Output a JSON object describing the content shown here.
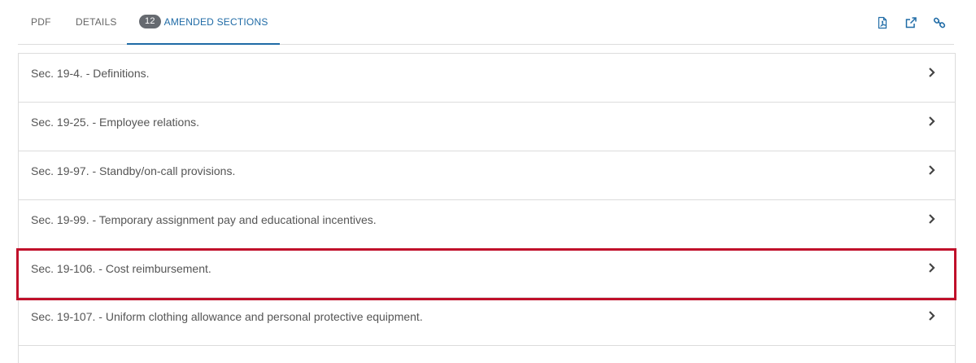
{
  "tabs": {
    "pdf": "PDF",
    "details": "DETAILS",
    "amended_count": "12",
    "amended": "AMENDED SECTIONS"
  },
  "toolbar": {
    "icons": [
      "pdf-file-icon",
      "external-link-icon",
      "link-icon"
    ],
    "accent_color": "#1f6ba6"
  },
  "sections": [
    {
      "label": "Sec. 19-4. - Definitions."
    },
    {
      "label": "Sec. 19-25. - Employee relations."
    },
    {
      "label": "Sec. 19-97. - Standby/on-call provisions."
    },
    {
      "label": "Sec. 19-99. - Temporary assignment pay and educational incentives."
    },
    {
      "label": "Sec. 19-106. - Cost reimbursement.",
      "highlighted": true
    },
    {
      "label": "Sec. 19-107. - Uniform clothing allowance and personal protective equipment."
    }
  ],
  "highlight_color": "#c0102a"
}
